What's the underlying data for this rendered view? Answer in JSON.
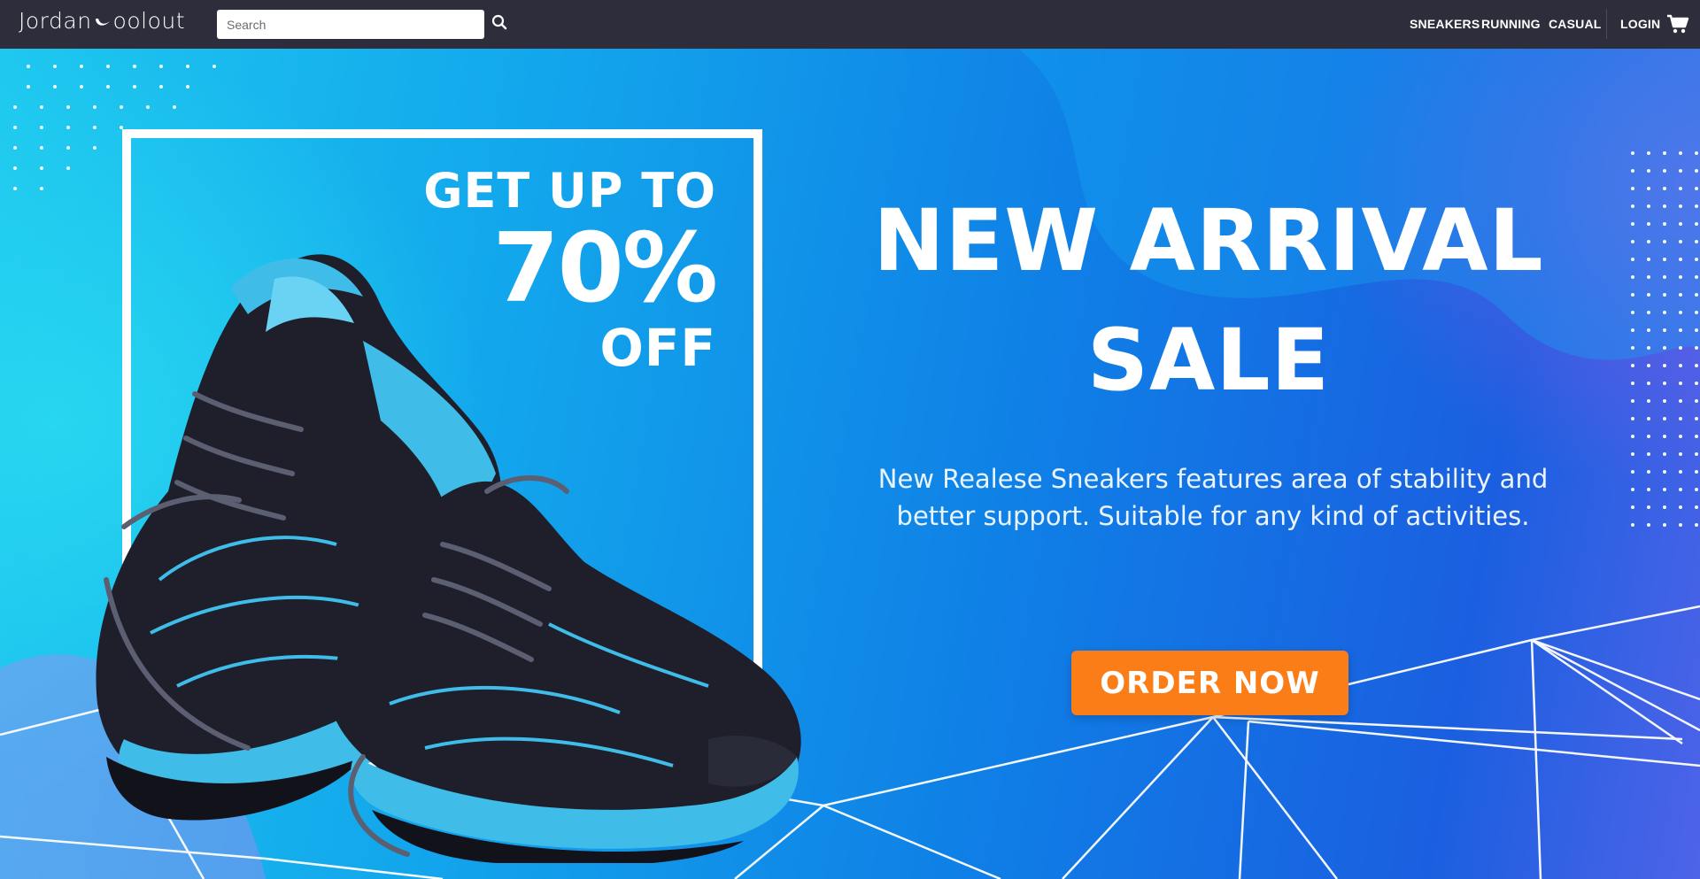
{
  "navbar": {
    "brand_left": "Jordan",
    "brand_right": "oolout",
    "search_placeholder": "Search",
    "links": [
      "SNEAKERS",
      "RUNNING",
      "CASUAL"
    ],
    "login": "LOGIN"
  },
  "hero": {
    "promo": {
      "line1": "GET UP TO",
      "line2": "70%",
      "line3": "OFF"
    },
    "headline_line1": "NEW ARRIVAL",
    "headline_line2": "SALE",
    "description": "New Realese Sneakers features area of stability and better support. Suitable for any kind of activities.",
    "cta": "ORDER NOW"
  },
  "colors": {
    "navbar_bg": "#2d2d3b",
    "cta_bg": "#fb7d17",
    "hero_cyan": "#1ec8ef",
    "hero_blue": "#0f7fe6",
    "shoe_accent": "#3fbde8"
  },
  "icons": [
    "search-icon",
    "cart-icon",
    "brand-swoosh-icon"
  ]
}
